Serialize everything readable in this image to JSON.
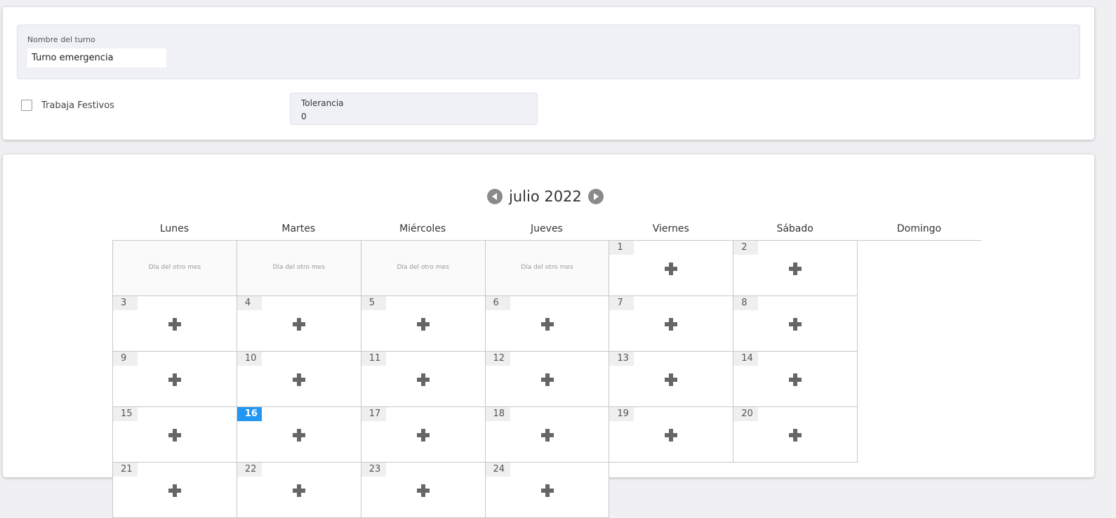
{
  "form": {
    "name_label": "Nombre del turno",
    "name_value": "Turno emergencia",
    "holiday_label": "Trabaja Festivos",
    "holiday_checked": false,
    "tolerance_label": "Tolerancia",
    "tolerance_value": "0"
  },
  "calendar": {
    "month_title": "julio 2022",
    "weekdays": [
      "Lunes",
      "Martes",
      "Miércoles",
      "Jueves",
      "Viernes",
      "Sábado",
      "Domingo"
    ],
    "other_month_text": "Día del otro mes",
    "today": "16",
    "today_color": "#2196f3",
    "cells": [
      {
        "other": true
      },
      {
        "other": true
      },
      {
        "other": true
      },
      {
        "other": true
      },
      {
        "day": "1"
      },
      {
        "day": "2"
      },
      {
        "day": "3"
      },
      {
        "day": "4"
      },
      {
        "day": "5"
      },
      {
        "day": "6"
      },
      {
        "day": "7"
      },
      {
        "day": "8"
      },
      {
        "day": "9"
      },
      {
        "day": "10"
      },
      {
        "day": "11"
      },
      {
        "day": "12"
      },
      {
        "day": "13"
      },
      {
        "day": "14"
      },
      {
        "day": "15"
      },
      {
        "day": "16"
      },
      {
        "day": "17"
      },
      {
        "day": "18"
      },
      {
        "day": "19"
      },
      {
        "day": "20"
      },
      {
        "day": "21"
      },
      {
        "day": "22"
      },
      {
        "day": "23"
      },
      {
        "day": "24"
      }
    ]
  },
  "icons": {
    "prev": "chevron-left-circle-icon",
    "next": "chevron-right-circle-icon",
    "add": "plus-icon"
  }
}
